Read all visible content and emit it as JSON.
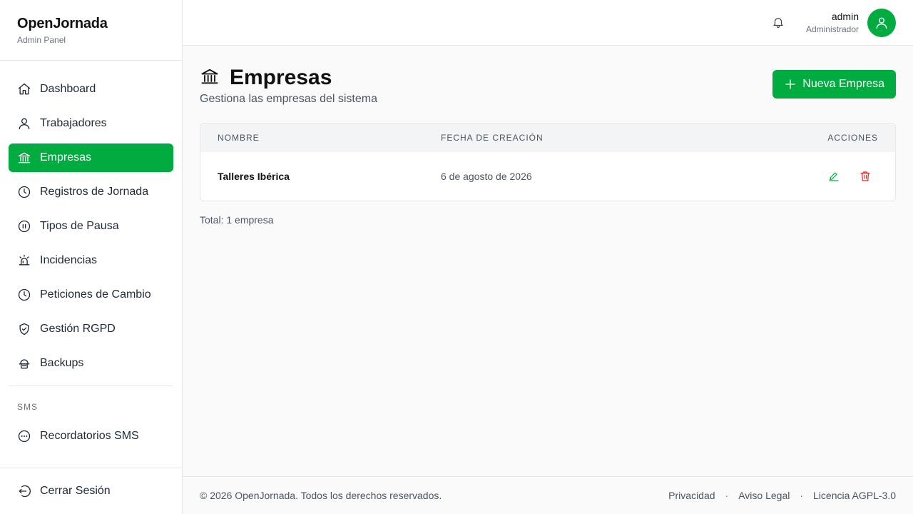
{
  "brand": {
    "title": "OpenJornada",
    "subtitle": "Admin Panel"
  },
  "sidebar": {
    "items": [
      {
        "label": "Dashboard",
        "icon": "home-icon"
      },
      {
        "label": "Trabajadores",
        "icon": "user-icon"
      },
      {
        "label": "Empresas",
        "icon": "bank-icon",
        "active": true
      },
      {
        "label": "Registros de Jornada",
        "icon": "clock-icon"
      },
      {
        "label": "Tipos de Pausa",
        "icon": "pause-circle-icon"
      },
      {
        "label": "Incidencias",
        "icon": "alarm-icon"
      },
      {
        "label": "Peticiones de Cambio",
        "icon": "clock-icon"
      },
      {
        "label": "Gestión RGPD",
        "icon": "shield-check-icon"
      },
      {
        "label": "Backups",
        "icon": "cloud-storage-icon"
      }
    ],
    "section_sms": "SMS",
    "sms_items": [
      {
        "label": "Recordatorios SMS",
        "icon": "chat-dots-icon"
      }
    ],
    "logout": "Cerrar Sesión"
  },
  "header": {
    "user_name": "admin",
    "user_role": "Administrador"
  },
  "page": {
    "title": "Empresas",
    "subtitle": "Gestiona las empresas del sistema",
    "new_button": "Nueva Empresa"
  },
  "table": {
    "columns": [
      "NOMBRE",
      "FECHA DE CREACIÓN",
      "ACCIONES"
    ],
    "rows": [
      {
        "name": "Talleres Ibérica",
        "created": "6 de agosto de 2026"
      }
    ],
    "total": "Total: 1 empresa"
  },
  "footer": {
    "copyright": "© 2026 OpenJornada. Todos los derechos reservados.",
    "links": [
      "Privacidad",
      "Aviso Legal",
      "Licencia AGPL-3.0"
    ]
  },
  "colors": {
    "accent": "#00ac3f",
    "danger": "#dc2626"
  }
}
